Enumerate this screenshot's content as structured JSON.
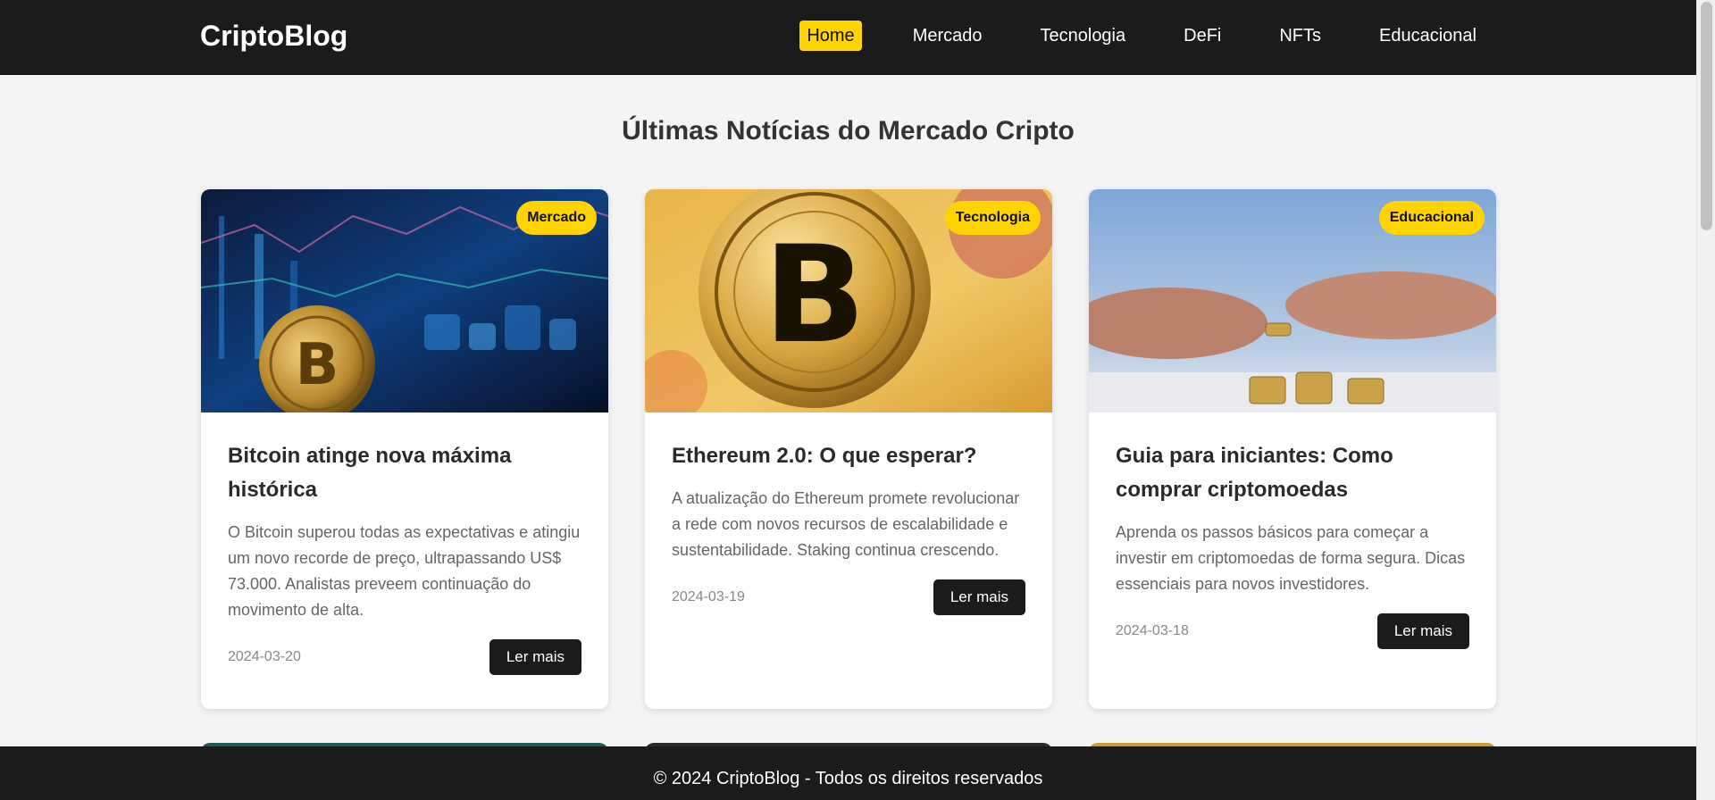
{
  "brand": "CriptoBlog",
  "nav": [
    "Home",
    "Mercado",
    "Tecnologia",
    "DeFi",
    "NFTs",
    "Educacional"
  ],
  "heading": "Últimas Notícias do Mercado Cripto",
  "posts": [
    {
      "category": "Mercado",
      "title": "Bitcoin atinge nova máxima histórica",
      "excerpt": "O Bitcoin superou todas as expectativas e atingiu um novo recorde de preço, ultrapassando US$ 73.000. Analistas preveem continuação do movimento de alta.",
      "date": "2024-03-20",
      "button": "Ler mais"
    },
    {
      "category": "Tecnologia",
      "title": "Ethereum 2.0: O que esperar?",
      "excerpt": "A atualização do Ethereum promete revolucionar a rede com novos recursos de escalabilidade e sustentabilidade. Staking continua crescendo.",
      "date": "2024-03-19",
      "button": "Ler mais"
    },
    {
      "category": "Educacional",
      "title": "Guia para iniciantes: Como comprar criptomoedas",
      "excerpt": "Aprenda os passos básicos para começar a investir em criptomoedas de forma segura. Dicas essenciais para novos investidores.",
      "date": "2024-03-18",
      "button": "Ler mais"
    }
  ],
  "footer": "© 2024 CriptoBlog - Todos os direitos reservados",
  "colors": {
    "accent": "#ffd400",
    "dark": "#1b1b1b",
    "background": "#f4f4f4"
  }
}
